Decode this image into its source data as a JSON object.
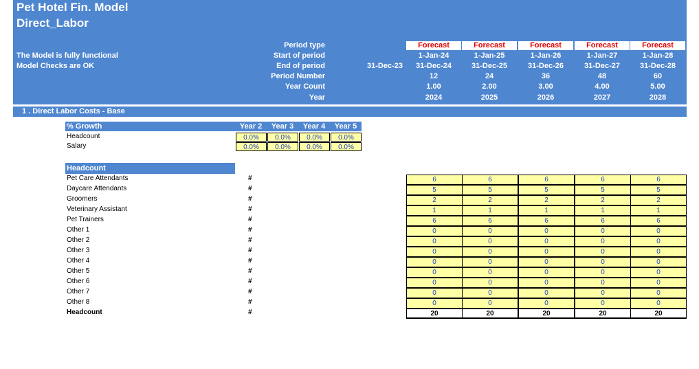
{
  "header": {
    "title": "Pet Hotel Fin. Model",
    "sheet": "Direct_Labor",
    "status1": "The Model is fully functional",
    "status2": "Model Checks are OK",
    "labels": [
      "Period type",
      "Start of period",
      "End of period",
      "Period Number",
      "Year Count",
      "Year"
    ],
    "pre_end_of_period": "31-Dec-23",
    "columns": [
      {
        "type": "Forecast",
        "start": "1-Jan-24",
        "end": "31-Dec-24",
        "period": "12",
        "count": "1.00",
        "year": "2024"
      },
      {
        "type": "Forecast",
        "start": "1-Jan-25",
        "end": "31-Dec-25",
        "period": "24",
        "count": "2.00",
        "year": "2025"
      },
      {
        "type": "Forecast",
        "start": "1-Jan-26",
        "end": "31-Dec-26",
        "period": "36",
        "count": "3.00",
        "year": "2026"
      },
      {
        "type": "Forecast",
        "start": "1-Jan-27",
        "end": "31-Dec-27",
        "period": "48",
        "count": "4.00",
        "year": "2027"
      },
      {
        "type": "Forecast",
        "start": "1-Jan-28",
        "end": "31-Dec-28",
        "period": "60",
        "count": "5.00",
        "year": "2028"
      }
    ]
  },
  "section": {
    "title": "1 . Direct Labor Costs - Base"
  },
  "growth": {
    "title": "% Growth",
    "years": [
      "Year 2",
      "Year 3",
      "Year 4",
      "Year 5"
    ],
    "rows": [
      {
        "label": "Headcount",
        "values": [
          "0.0%",
          "0.0%",
          "0.0%",
          "0.0%"
        ]
      },
      {
        "label": "Salary",
        "values": [
          "0.0%",
          "0.0%",
          "0.0%",
          "0.0%"
        ]
      }
    ]
  },
  "headcount": {
    "title": "Headcount",
    "unit": "#",
    "rows": [
      {
        "label": "Pet Care Attendants",
        "values": [
          "6",
          "6",
          "6",
          "6",
          "6"
        ]
      },
      {
        "label": "Daycare Attendants",
        "values": [
          "5",
          "5",
          "5",
          "5",
          "5"
        ]
      },
      {
        "label": "Groomers",
        "values": [
          "2",
          "2",
          "2",
          "2",
          "2"
        ]
      },
      {
        "label": "Veterinary Assistant",
        "values": [
          "1",
          "1",
          "1",
          "1",
          "1"
        ]
      },
      {
        "label": "Pet Trainers",
        "values": [
          "6",
          "6",
          "6",
          "6",
          "6"
        ]
      },
      {
        "label": "Other 1",
        "values": [
          "0",
          "0",
          "0",
          "0",
          "0"
        ]
      },
      {
        "label": "Other 2",
        "values": [
          "0",
          "0",
          "0",
          "0",
          "0"
        ]
      },
      {
        "label": "Other 3",
        "values": [
          "0",
          "0",
          "0",
          "0",
          "0"
        ]
      },
      {
        "label": "Other 4",
        "values": [
          "0",
          "0",
          "0",
          "0",
          "0"
        ]
      },
      {
        "label": "Other 5",
        "values": [
          "0",
          "0",
          "0",
          "0",
          "0"
        ]
      },
      {
        "label": "Other 6",
        "values": [
          "0",
          "0",
          "0",
          "0",
          "0"
        ]
      },
      {
        "label": "Other 7",
        "values": [
          "0",
          "0",
          "0",
          "0",
          "0"
        ]
      },
      {
        "label": "Other 8",
        "values": [
          "0",
          "0",
          "0",
          "0",
          "0"
        ]
      }
    ],
    "total": {
      "label": "Headcount",
      "values": [
        "20",
        "20",
        "20",
        "20",
        "20"
      ]
    }
  }
}
